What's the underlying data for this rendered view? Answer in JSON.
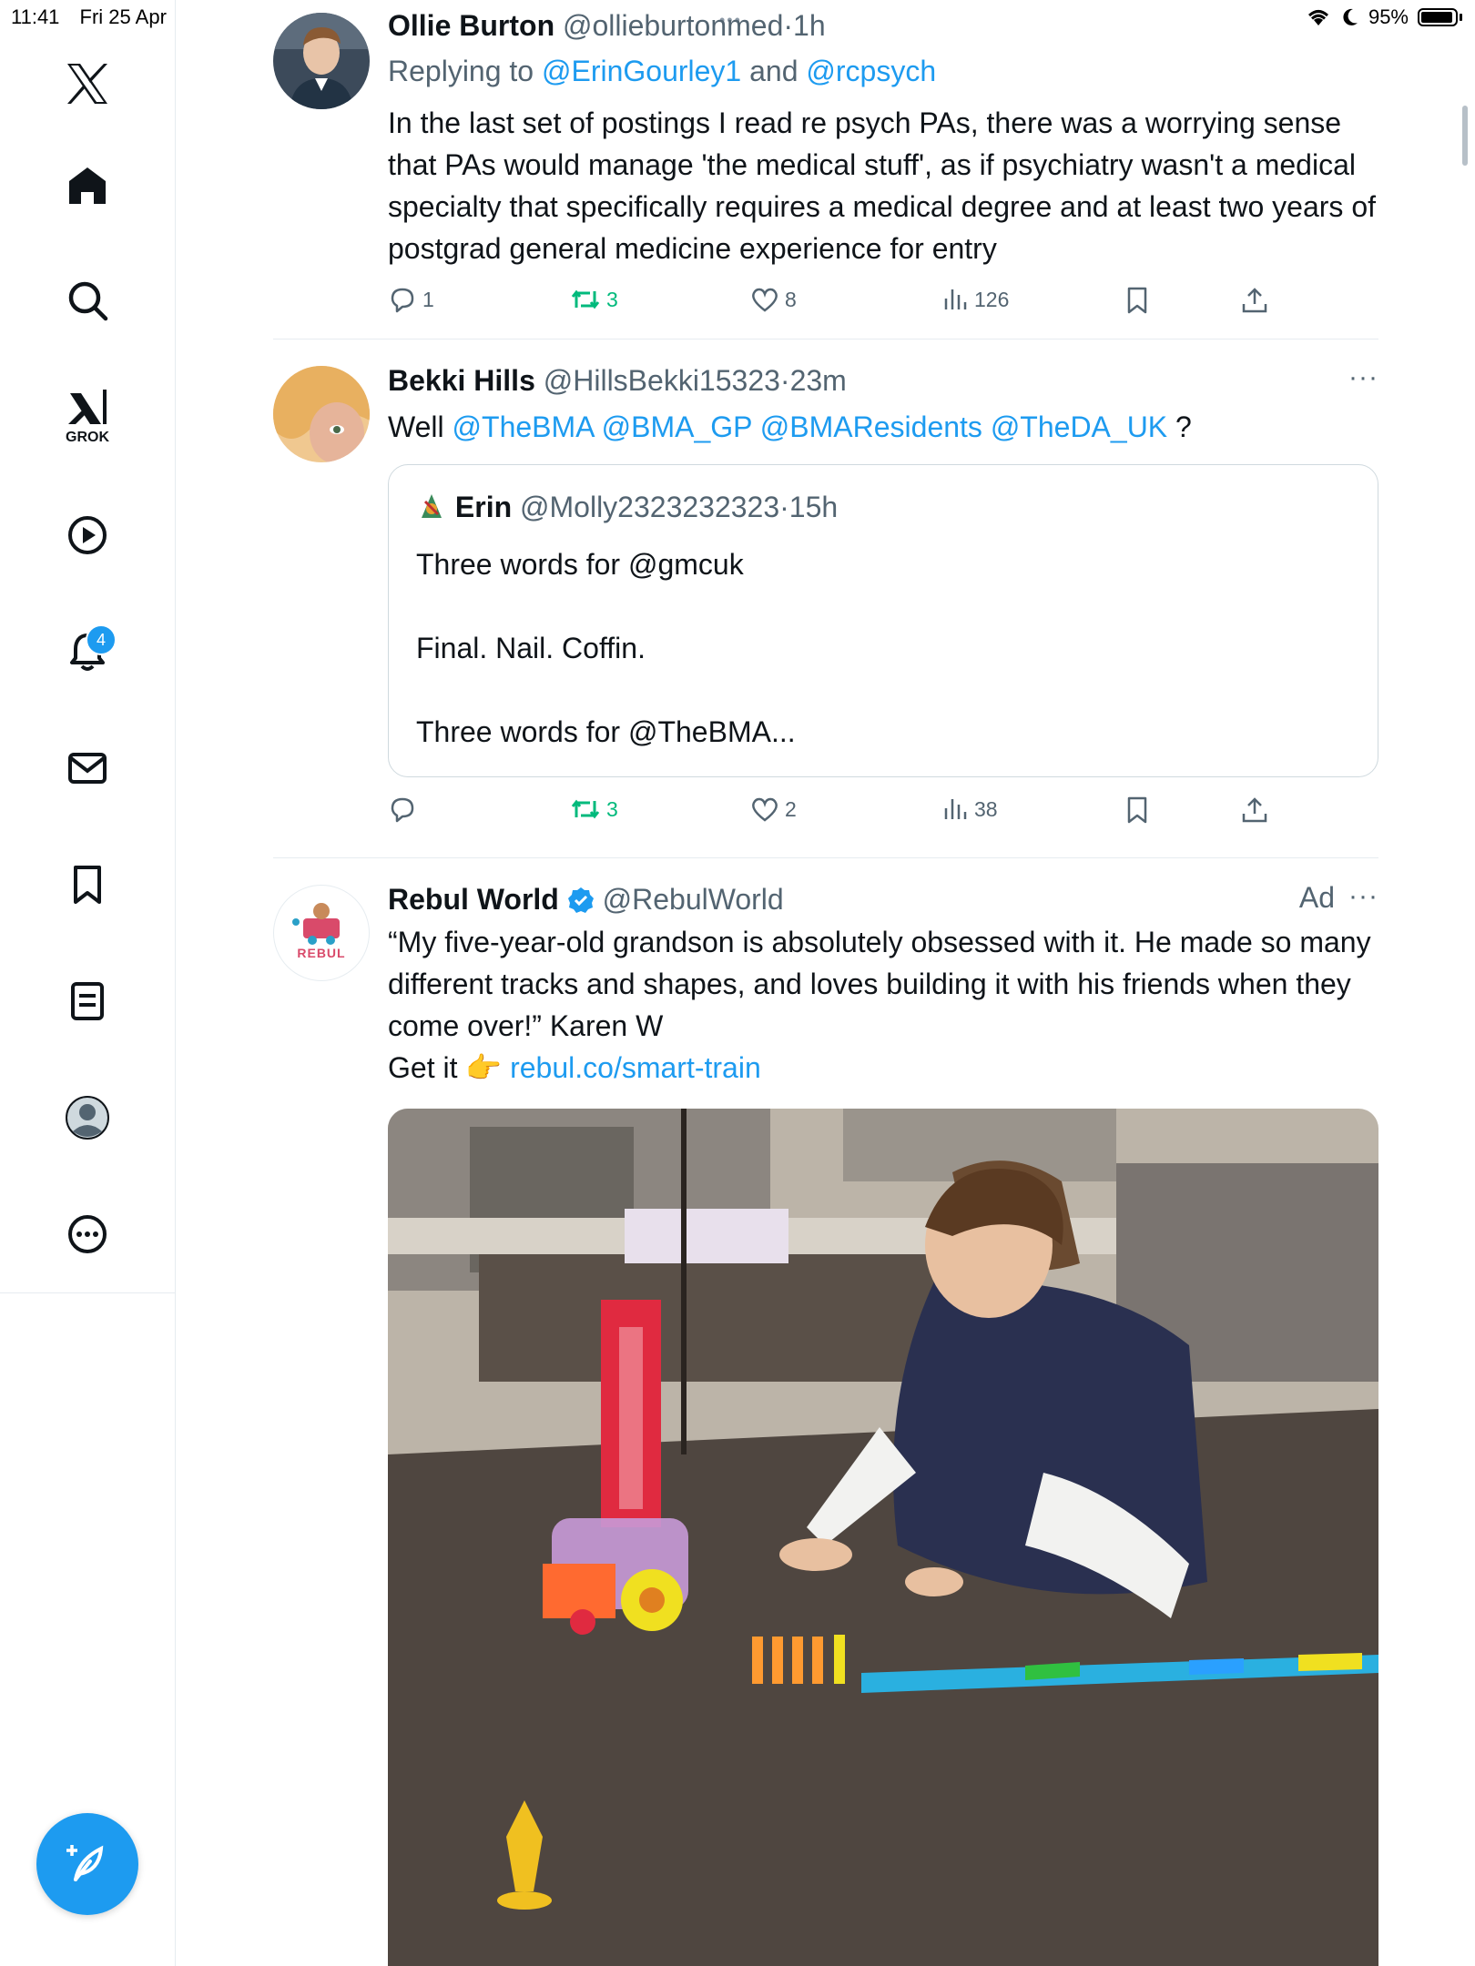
{
  "status_bar": {
    "time": "11:41",
    "date": "Fri 25 Apr",
    "battery": "95%",
    "dnd_icon": "moon-icon",
    "wifi_icon": "wifi-icon"
  },
  "sidebar": {
    "items": [
      {
        "name": "x-logo",
        "icon": "x-logo-icon"
      },
      {
        "name": "home",
        "icon": "home-icon"
      },
      {
        "name": "search",
        "icon": "search-icon"
      },
      {
        "name": "grok",
        "icon": "grok-icon",
        "label": "GROK"
      },
      {
        "name": "videos",
        "icon": "play-icon"
      },
      {
        "name": "notifications",
        "icon": "bell-icon",
        "badge": "4"
      },
      {
        "name": "messages",
        "icon": "mail-icon"
      },
      {
        "name": "bookmarks",
        "icon": "bookmark-icon"
      },
      {
        "name": "lists",
        "icon": "list-icon"
      },
      {
        "name": "profile",
        "icon": "profile-icon"
      },
      {
        "name": "more",
        "icon": "more-circle-icon"
      }
    ],
    "compose_icon": "compose-icon"
  },
  "tweets": [
    {
      "name": "Ollie Burton",
      "handle": "@ollieburtonmed",
      "sep": "·",
      "time": "1h",
      "reply_prefix": "Replying to ",
      "reply_user1": "@ErinGourley1",
      "reply_and": " and ",
      "reply_user2": "@rcpsych",
      "text": "In the last set of postings I read re psych PAs, there was a worrying sense that PAs would manage 'the medical stuff', as if psychiatry wasn't a medical specialty that specifically requires a medical degree and at least two years of postgrad general medicine experience for entry",
      "replies": "1",
      "reposts": "3",
      "likes": "8",
      "views": "126"
    },
    {
      "name": "Bekki Hills",
      "handle": "@HillsBekki15323",
      "sep": "·",
      "time": "23m",
      "more": "···",
      "text_prefix": "Well ",
      "mentions": [
        "@TheBMA",
        "@BMA_GP",
        "@BMAResidents",
        "@TheDA_UK"
      ],
      "text_suffix": " ?",
      "quote": {
        "name": "Erin",
        "handle": "@Molly2323232323",
        "sep": "·",
        "time": "15h",
        "line1": "Three words for @gmcuk",
        "line2": "Final. Nail. Coffin.",
        "line3": "Three words for @TheBMA..."
      },
      "replies": "",
      "reposts": "3",
      "likes": "2",
      "views": "38"
    },
    {
      "name": "Rebul World",
      "handle": "@RebulWorld",
      "verified": true,
      "ad_label": "Ad",
      "more": "···",
      "avatar_text": "REBUL",
      "text": "“My five-year-old grandson is absolutely obsessed with it. He made so many different tracks and shapes, and loves building it with his friends when they come over!” Karen W",
      "cta_prefix": "Get it 👉 ",
      "cta_link": "rebul.co/smart-train"
    }
  ],
  "colors": {
    "accent": "#1d9bf0",
    "repost_green": "#00ba7c",
    "secondary_text": "#536471"
  }
}
